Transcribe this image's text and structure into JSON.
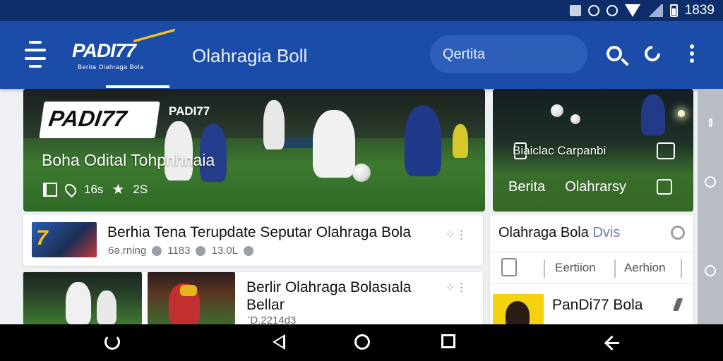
{
  "status_bar": {
    "time": "1839"
  },
  "app_bar": {
    "logo_text": "PADI77",
    "logo_tagline": "Berita Olahraga Bola",
    "title": "Olahragia Boll",
    "search_placeholder": "Qertita"
  },
  "hero": {
    "logo_word": "PADI77",
    "brand": "PADI77",
    "title": "Boha Odital Tohpnhnaia",
    "views": "16s",
    "stars": "2S"
  },
  "side_card": {
    "banner": "Biaiclac Carpanbi",
    "link_1": "Berita",
    "link_2": "Olahrarsy"
  },
  "list": {
    "item_1": {
      "title": "Berhia Tena Terupdate Seputar Olahraga Bola",
      "meta_source": "6ə.rning",
      "meta_count": "1183",
      "meta_likes": "13.0L"
    },
    "item_2": {
      "title_line_1": "Berlir Olahraga Bolasıala",
      "title_line_2": "Bellar",
      "meta": "ʻD.2214d3"
    }
  },
  "panel": {
    "title": "Olahraga Bola",
    "title_sub": "Dvis",
    "link_1": "Eertiion",
    "link_2": "Aerhion",
    "item_title": "PanDi77 Bola"
  },
  "colors": {
    "status_bar": "#0e2d6b",
    "app_bar": "#1a4ca8",
    "brand_yellow": "#f4c21b"
  }
}
